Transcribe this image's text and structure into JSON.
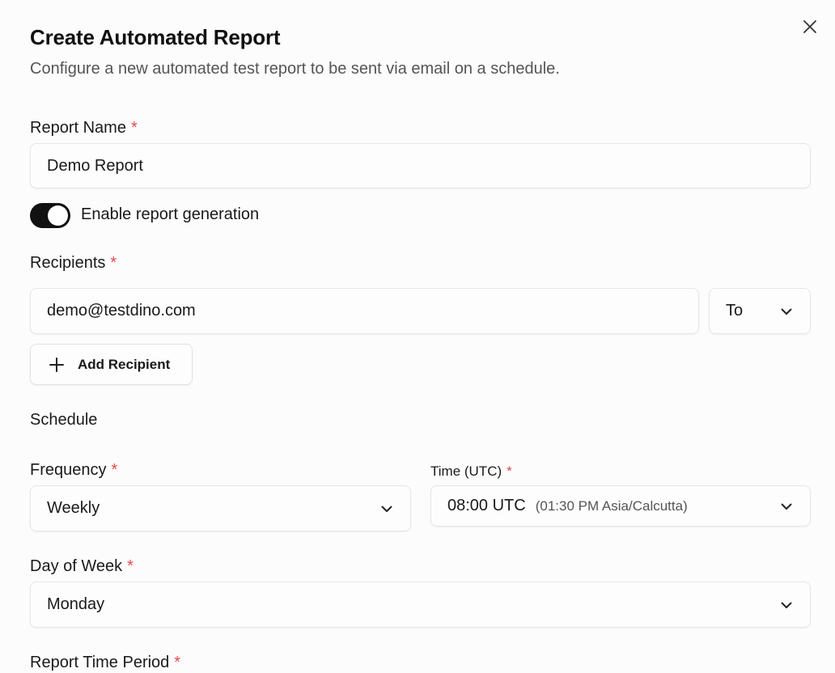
{
  "dialog": {
    "title": "Create Automated Report",
    "subtitle": "Configure a new automated test report to be sent via email on a schedule.",
    "close_icon": "close-icon"
  },
  "report_name": {
    "label": "Report Name",
    "required_mark": "*",
    "value": "Demo Report"
  },
  "enable_toggle": {
    "label": "Enable report generation",
    "on": true
  },
  "recipients": {
    "label": "Recipients",
    "required_mark": "*",
    "email": "demo@testdino.com",
    "type_value": "To",
    "add_button_label": "Add Recipient",
    "add_icon": "plus-icon"
  },
  "schedule": {
    "section_title": "Schedule",
    "frequency": {
      "label": "Frequency",
      "required_mark": "*",
      "value": "Weekly"
    },
    "time": {
      "label": "Time (UTC)",
      "required_mark": "*",
      "value": "08:00 UTC",
      "local_hint": "(01:30 PM Asia/Calcutta)"
    },
    "day_of_week": {
      "label": "Day of Week",
      "required_mark": "*",
      "value": "Monday"
    }
  },
  "report_time_period": {
    "label": "Report Time Period",
    "required_mark": "*"
  },
  "colors": {
    "required": "#e5484d",
    "toggle_on": "#111111"
  }
}
